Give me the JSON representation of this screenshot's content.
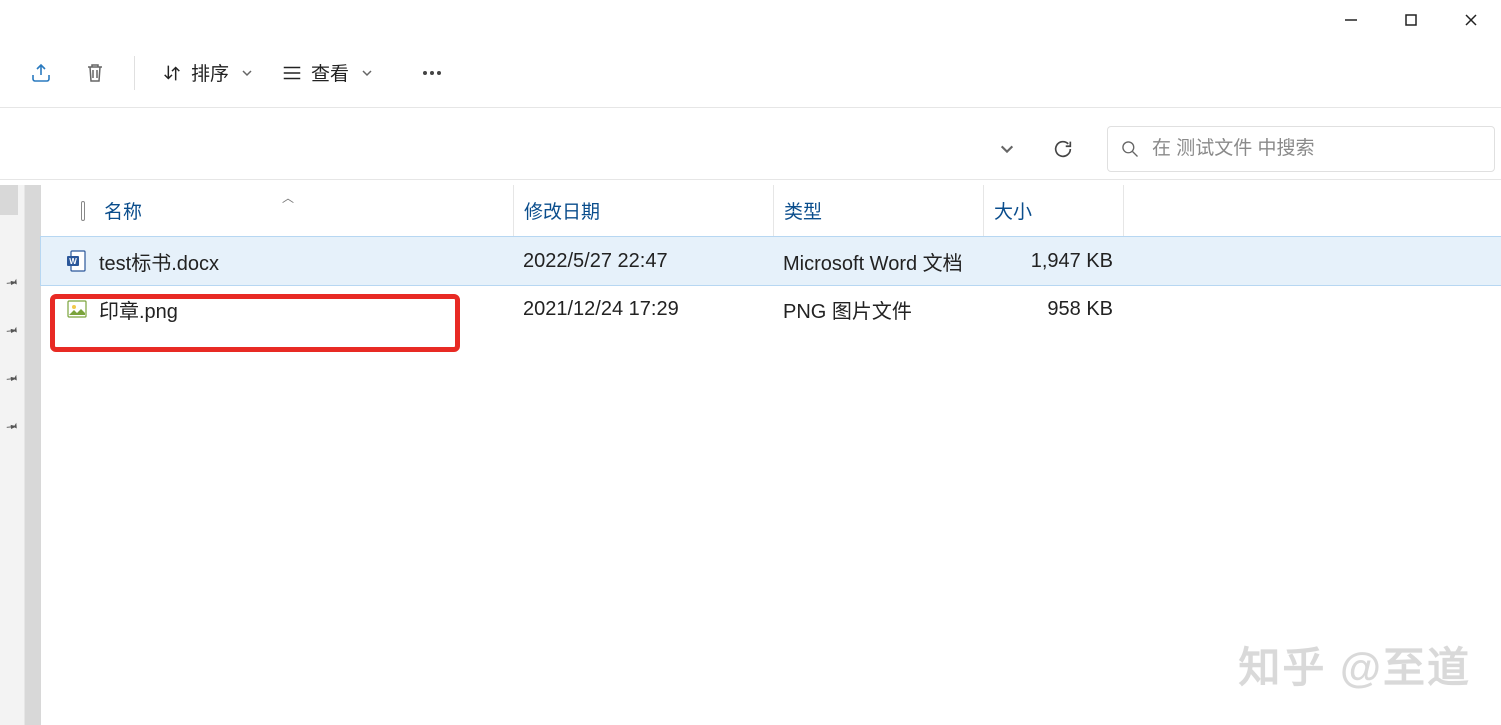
{
  "window": {
    "minimize": "minimize",
    "maximize": "maximize",
    "close": "close"
  },
  "toolbar": {
    "sort_label": "排序",
    "view_label": "查看"
  },
  "addressbar": {
    "search_placeholder": "在 测试文件 中搜索"
  },
  "columns": {
    "name": "名称",
    "date": "修改日期",
    "type": "类型",
    "size": "大小"
  },
  "files": [
    {
      "icon": "word",
      "name": "test标书.docx",
      "date": "2022/5/27 22:47",
      "type": "Microsoft Word 文档",
      "size": "1,947 KB",
      "selected": true,
      "highlighted": false
    },
    {
      "icon": "png",
      "name": "印章.png",
      "date": "2021/12/24 17:29",
      "type": "PNG 图片文件",
      "size": "958 KB",
      "selected": false,
      "highlighted": true
    }
  ],
  "watermark": "知乎 @至道"
}
